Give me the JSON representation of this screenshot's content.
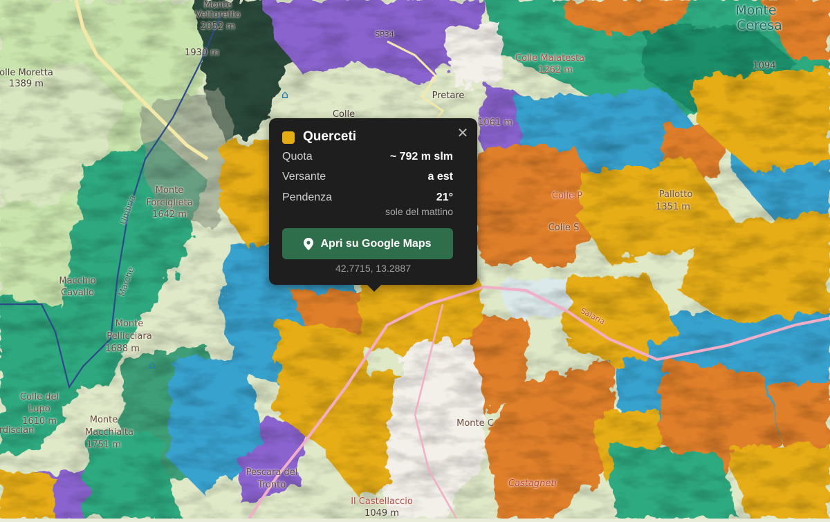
{
  "map": {
    "labels": [
      {
        "id": "monte-vettoretto-name",
        "text": "Monte"
      },
      {
        "id": "monte-vettoretto-name2",
        "text": "Vettoretto"
      },
      {
        "id": "monte-vettoretto-elev",
        "text": "2052 m"
      },
      {
        "id": "elev-1930",
        "text": "1930 m"
      },
      {
        "id": "colle-moretta",
        "text": "olle Moretta"
      },
      {
        "id": "colle-moretta-elev",
        "text": "1389 m"
      },
      {
        "id": "monte-forciglieta",
        "text": "Monte"
      },
      {
        "id": "monte-forciglieta2",
        "text": "Forciglieta"
      },
      {
        "id": "monte-forciglieta-elev",
        "text": "1642 m"
      },
      {
        "id": "macchio-cavallo",
        "text": "Macchio"
      },
      {
        "id": "macchio-cavallo2",
        "text": "Cavallo"
      },
      {
        "id": "monte-pellicciara",
        "text": "Monte"
      },
      {
        "id": "monte-pellicciara2",
        "text": "Pellicciara"
      },
      {
        "id": "monte-pellicciara-elev",
        "text": "1688 m"
      },
      {
        "id": "colle-del-lupo",
        "text": "Colle del"
      },
      {
        "id": "colle-del-lupo2",
        "text": "Lupo"
      },
      {
        "id": "colle-del-lupo-elev",
        "text": "1610 m"
      },
      {
        "id": "monte-macchialta",
        "text": "Monte"
      },
      {
        "id": "monte-macchialta2",
        "text": "Macchialta"
      },
      {
        "id": "monte-macchialta-elev",
        "text": "1751 m"
      },
      {
        "id": "rdiscian",
        "text": "rdiscian"
      },
      {
        "id": "pretare",
        "text": "Pretare"
      },
      {
        "id": "colle-malatesta",
        "text": "Colle Malatesta"
      },
      {
        "id": "colle-malatesta-elev",
        "text": "1262 m"
      },
      {
        "id": "colle-top",
        "text": "Colle"
      },
      {
        "id": "sp",
        "text": "SP34"
      },
      {
        "id": "monte-ceresa",
        "text": "Monte"
      },
      {
        "id": "monte-ceresa2",
        "text": "Ceresa"
      },
      {
        "id": "elev-1094",
        "text": "1094"
      },
      {
        "id": "elev-1061",
        "text": "1061 m"
      },
      {
        "id": "colle-p",
        "text": "Colle P"
      },
      {
        "id": "colle-p2",
        "text": "Colle S"
      },
      {
        "id": "pallotto",
        "text": "Pallotto"
      },
      {
        "id": "elev-1351",
        "text": "1351 m"
      },
      {
        "id": "pescara-del-tronto",
        "text": "Pescara del"
      },
      {
        "id": "pescara-del-tronto2",
        "text": "Tronto"
      },
      {
        "id": "il-castellaccio",
        "text": "Il Castellaccio"
      },
      {
        "id": "il-castellaccio-elev",
        "text": "1049 m"
      },
      {
        "id": "castagneti",
        "text": "Castagneti"
      },
      {
        "id": "monte-c",
        "text": "Monte C"
      },
      {
        "id": "road-marche",
        "text": "Marche"
      },
      {
        "id": "road-umbria",
        "text": "Umbria"
      },
      {
        "id": "road-salaria",
        "text": "Salaria"
      }
    ]
  },
  "popup": {
    "title": "Querceti",
    "swatch_color": "#e6ad12",
    "rows": [
      {
        "key": "Quota",
        "value": "~ 792 m slm"
      },
      {
        "key": "Versante",
        "value": "a est"
      },
      {
        "key": "Pendenza",
        "value": "21°"
      }
    ],
    "note": "sole del mattino",
    "button_label": "Apri su Google Maps",
    "button_icon": "map-pin-icon",
    "coords": "42.7715, 13.2887",
    "close_icon": "close-icon"
  },
  "colors": {
    "querceti": "#e6ad12",
    "faggete": "#29a37c",
    "castagneti": "#e07f2a",
    "pascoli": "#b9dfa0",
    "rocce": "#7d5fc8",
    "ostrieti": "#3aa3cf",
    "popup_bg": "#1e1e1e",
    "button_bg": "#2f6e4b"
  }
}
